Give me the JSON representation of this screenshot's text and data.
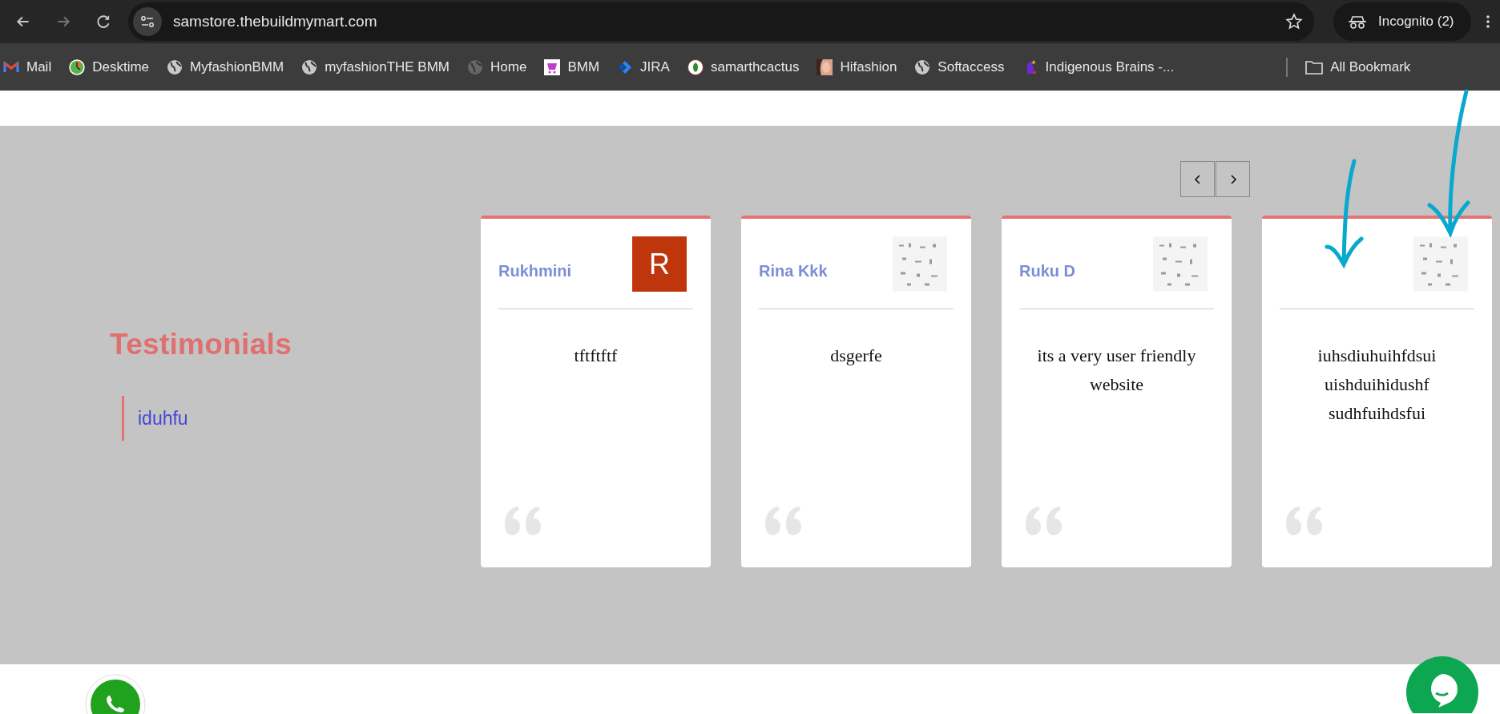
{
  "browser": {
    "url": "samstore.thebuildmymart.com",
    "profile": "Incognito (2)",
    "bookmarks": [
      {
        "label": "Mail",
        "kind": "mail"
      },
      {
        "label": "Desktime",
        "kind": "clock"
      },
      {
        "label": "MyfashionBMM",
        "kind": "globe"
      },
      {
        "label": "myfashionTHE BMM",
        "kind": "globe"
      },
      {
        "label": "Home",
        "kind": "earth"
      },
      {
        "label": "BMM",
        "kind": "cart"
      },
      {
        "label": "JIRA",
        "kind": "jira"
      },
      {
        "label": "samarthcactus",
        "kind": "cactus"
      },
      {
        "label": "Hifashion"
      },
      {
        "label": "Softaccess",
        "kind": "globe"
      },
      {
        "label": "Indigenous Brains -...",
        "kind": "figure"
      }
    ],
    "all_bookmarks": "All Bookmark"
  },
  "testimonials": {
    "title": "Testimonials",
    "quote": "iduhfu"
  },
  "carousel": {
    "cards": [
      {
        "name": "Rukhmini",
        "avatar": {
          "kind": "letter",
          "letter": "R",
          "color": "#bf360c"
        },
        "text": "tftftftf"
      },
      {
        "name": "Rina Kkk",
        "text": "dsgerfe"
      },
      {
        "name": "Ruku D",
        "text": "its a very user friendly website"
      },
      {
        "text": "iuhsdiuhuihfdsui uishduihidushf sudhfuihdsfui"
      }
    ]
  }
}
